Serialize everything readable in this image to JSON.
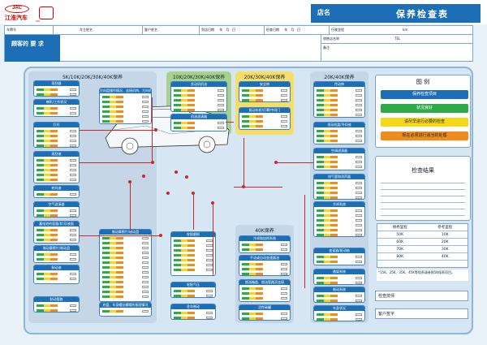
{
  "header": {
    "brand": "江淮汽车",
    "brand_logo": "JAC",
    "seal_caption": "ISO",
    "shop_label": "店名",
    "title": "保养检查表"
  },
  "info": {
    "row1": [
      "车牌号",
      "车主姓名",
      "客户姓名"
    ],
    "date_in": "到店日期",
    "date_check": "检查日期",
    "date_labels": [
      "年",
      "月",
      "日"
    ],
    "mileage": "行驶里程",
    "mileage_unit": "km",
    "request": "顾客的 要 求",
    "sales_name": "销售店名称",
    "tel": "TEL",
    "remark": "备注"
  },
  "groups": {
    "g5k": "5K/10K/20K/30K/40K保养",
    "g10k": "10K/20K/30K/40K保养",
    "g20k": "20K/30K/40K保养",
    "g20k2": "20K/40K保养",
    "g40k": "40K保养"
  },
  "cards_left": [
    "雨刮器",
    "喇叭/工作状况",
    "灯光",
    "雨刮液",
    "转向液",
    "空气滤清器",
    "蓄电池的容量/状况/液面",
    "制动摩擦片/制动盘",
    "制动液",
    "制动管路"
  ],
  "cards_center": [
    "方向盘操作情况、连接机构、方向机状况",
    "制动摩擦片/制动盘",
    "轮胎磨损",
    "轮胎气压",
    "底盘、车身螺丝螺帽的紧固情况",
    "驻车制动"
  ],
  "cards_10k": [
    "发动机机油",
    "机油滤清器"
  ],
  "cards_20k": [
    "安全带",
    "驱动车桥/灯罩/中间门"
  ],
  "cards_40k": [
    "冷却和加热系统",
    "手动或自动变速器油",
    "燃油箱盖、燃油管路及连接",
    "活性碳罐"
  ],
  "cards_right": [
    "传动带",
    "发动机盖/冷却液",
    "空调滤清器",
    "排气管和消声器",
    "冷却系统",
    "变速器/驱动轴",
    "悬架系统",
    "制动系统",
    "车身状况"
  ],
  "legend": {
    "title": "图 例",
    "items": [
      "保养检查项目",
      "状况良好",
      "请尽早进行必要的检查",
      "现在必须进行适当的处理"
    ]
  },
  "results": {
    "title": "检查结果"
  },
  "schedule": {
    "headers": [
      "保养里程",
      "参考里程"
    ],
    "rows": [
      [
        "50K",
        "10K"
      ],
      [
        "60K",
        "20K"
      ],
      [
        "70K",
        "30K"
      ],
      [
        "80K",
        "40K"
      ]
    ],
    "note": "*15K、25K、35K、45K等保养请参照5K保养项目。"
  },
  "footer": {
    "inspector": "检查技师",
    "signature": "客户签字"
  },
  "colors": {
    "brand": "#1c6fb7",
    "good": "#2eaa4a",
    "soon": "#f5d817",
    "now": "#f08c1c",
    "line": "#c8282e"
  }
}
